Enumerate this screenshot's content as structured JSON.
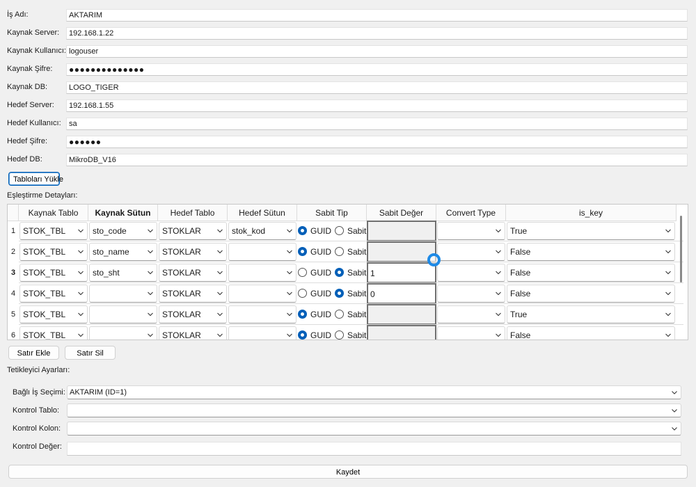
{
  "form": {
    "fields": [
      {
        "label": "İş Adı:",
        "value": "AKTARIM"
      },
      {
        "label": "Kaynak Server:",
        "value": "192.168.1.22"
      },
      {
        "label": "Kaynak Kullanıcı:",
        "value": "logouser"
      },
      {
        "label": "Kaynak Şifre:",
        "value": "●●●●●●●●●●●●●●"
      },
      {
        "label": "Kaynak DB:",
        "value": "LOGO_TIGER"
      },
      {
        "label": "Hedef Server:",
        "value": "192.168.1.55"
      },
      {
        "label": "Hedef Kullanıcı:",
        "value": "sa"
      },
      {
        "label": "Hedef Şifre:",
        "value": "●●●●●●"
      },
      {
        "label": "Hedef DB:",
        "value": "MikroDB_V16"
      }
    ],
    "load_tables_button": "Tabloları Yükle"
  },
  "mapping": {
    "section_label": "Eşleştirme Detayları:",
    "columns": [
      "Kaynak Tablo",
      "Kaynak Sütun",
      "Hedef Tablo",
      "Hedef Sütun",
      "Sabit Tip",
      "Sabit Değer",
      "Convert Type",
      "is_key"
    ],
    "radio_guid": "GUID",
    "radio_sabit": "Sabit",
    "rows": [
      {
        "num": "1",
        "kaynak_tablo": "STOK_TBL",
        "kaynak_sutun": "sto_code",
        "hedef_tablo": "STOKLAR",
        "hedef_sutun": "stok_kod",
        "sabit_tip": "GUID",
        "sabit_deger": "",
        "convert_type": "",
        "is_key": "True"
      },
      {
        "num": "2",
        "kaynak_tablo": "STOK_TBL",
        "kaynak_sutun": "sto_name",
        "hedef_tablo": "STOKLAR",
        "hedef_sutun": "",
        "sabit_tip": "GUID",
        "sabit_deger": "",
        "convert_type": "",
        "is_key": "False"
      },
      {
        "num": "3",
        "kaynak_tablo": "STOK_TBL",
        "kaynak_sutun": "sto_sht",
        "hedef_tablo": "STOKLAR",
        "hedef_sutun": "",
        "sabit_tip": "Sabit",
        "sabit_deger": "1",
        "convert_type": "",
        "is_key": "False"
      },
      {
        "num": "4",
        "kaynak_tablo": "STOK_TBL",
        "kaynak_sutun": "",
        "hedef_tablo": "STOKLAR",
        "hedef_sutun": "",
        "sabit_tip": "Sabit",
        "sabit_deger": "0",
        "convert_type": "",
        "is_key": "False"
      },
      {
        "num": "5",
        "kaynak_tablo": "STOK_TBL",
        "kaynak_sutun": "",
        "hedef_tablo": "STOKLAR",
        "hedef_sutun": "",
        "sabit_tip": "GUID",
        "sabit_deger": "",
        "convert_type": "",
        "is_key": "True"
      },
      {
        "num": "6",
        "kaynak_tablo": "STOK_TBL",
        "kaynak_sutun": "",
        "hedef_tablo": "STOKLAR",
        "hedef_sutun": "",
        "sabit_tip": "GUID",
        "sabit_deger": "",
        "convert_type": "",
        "is_key": "False"
      }
    ],
    "add_row_button": "Satır Ekle",
    "delete_row_button": "Satır Sil"
  },
  "trigger": {
    "section_label": "Tetikleyici Ayarları:",
    "fields": [
      {
        "label": "Bağlı İş Seçimi:",
        "value": "AKTARIM (ID=1)",
        "type": "combo"
      },
      {
        "label": "Kontrol Tablo:",
        "value": "",
        "type": "combo"
      },
      {
        "label": "Kontrol Kolon:",
        "value": "",
        "type": "combo"
      },
      {
        "label": "Kontrol Değer:",
        "value": "",
        "type": "input"
      }
    ]
  },
  "save_button": "Kaydet",
  "colors": {
    "accent": "#005fb8",
    "background": "#f0f0f0",
    "cursor": "#1e8ae6"
  },
  "icons": [
    "chevron-down-icon",
    "radio-selected-icon",
    "radio-unselected-icon",
    "busy-cursor-icon"
  ]
}
